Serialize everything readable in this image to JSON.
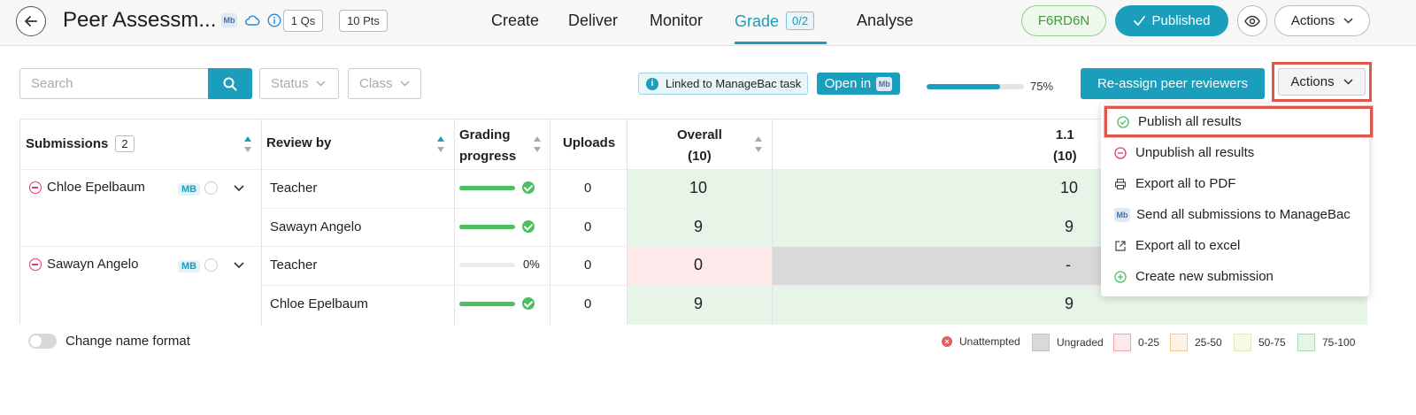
{
  "header": {
    "title": "Peer Assessm...",
    "mb_badge": "Mb",
    "questions": "1 Qs",
    "points": "10 Pts",
    "tabs": [
      {
        "label": "Create"
      },
      {
        "label": "Deliver"
      },
      {
        "label": "Monitor"
      },
      {
        "label": "Grade",
        "count": "0/2",
        "active": true
      },
      {
        "label": "Analyse"
      }
    ],
    "code": "F6RD6N",
    "published_label": "Published",
    "actions_label": "Actions"
  },
  "toolbar": {
    "search_placeholder": "Search",
    "status_filter": "Status",
    "class_filter": "Class",
    "linked_label": "Linked to ManageBac task",
    "open_in_label": "Open in",
    "open_in_badge": "Mb",
    "progress_percent": 75,
    "progress_text": "75%",
    "reassign_label": "Re-assign peer reviewers",
    "actions_label": "Actions"
  },
  "table": {
    "headers": {
      "submissions": "Submissions",
      "submissions_count": "2",
      "review_by": "Review by",
      "grading_progress_1": "Grading",
      "grading_progress_2": "progress",
      "uploads": "Uploads",
      "overall_1": "Overall",
      "overall_2": "(10)",
      "q11_1": "1.1",
      "q11_2": "(10)"
    },
    "rows": [
      {
        "student": "Chloe Epelbaum",
        "tag": "MB",
        "reviewer": "Teacher",
        "progress": 1.0,
        "progress_label": "",
        "uploads": "0",
        "overall": "10",
        "q11": "10",
        "band": "75-100"
      },
      {
        "student": "",
        "tag": "",
        "reviewer": "Sawayn Angelo",
        "progress": 1.0,
        "progress_label": "",
        "uploads": "0",
        "overall": "9",
        "q11": "9",
        "band": "75-100"
      },
      {
        "student": "Sawayn Angelo",
        "tag": "MB",
        "reviewer": "Teacher",
        "progress": 0.0,
        "progress_label": "0%",
        "uploads": "0",
        "overall": "0",
        "q11": "-",
        "band": "0-25"
      },
      {
        "student": "",
        "tag": "",
        "reviewer": "Chloe Epelbaum",
        "progress": 1.0,
        "progress_label": "",
        "uploads": "0",
        "overall": "9",
        "q11": "9",
        "band": "75-100"
      }
    ]
  },
  "footer": {
    "toggle_label": "Change name format",
    "legend": [
      {
        "label": "Unattempted"
      },
      {
        "label": "Ungraded",
        "color": "#d9d9d9",
        "border": "#c4c4c4"
      },
      {
        "label": "0-25",
        "color": "#fde9ea",
        "border": "#f0a7ae"
      },
      {
        "label": "25-50",
        "color": "#fef3e6",
        "border": "#f3c98f"
      },
      {
        "label": "50-75",
        "color": "#f7fbe6",
        "border": "#dfe9b0"
      },
      {
        "label": "75-100",
        "color": "#e7f5e8",
        "border": "#a9dcae"
      }
    ]
  },
  "dropdown": {
    "items": [
      {
        "label": "Publish all results",
        "icon": "check-circle-icon"
      },
      {
        "label": "Unpublish all results",
        "icon": "minus-circle-icon"
      },
      {
        "label": "Export all to PDF",
        "icon": "printer-icon"
      },
      {
        "label": "Send all submissions to ManageBac",
        "icon": "managebac-icon"
      },
      {
        "label": "Export all to excel",
        "icon": "external-link-icon"
      },
      {
        "label": "Create new submission",
        "icon": "plus-circle-icon"
      }
    ]
  },
  "colors": {
    "accent": "#1b9dbc",
    "highlight": "#e0574d",
    "green_band": "#e7f5e8",
    "red_band": "#fde9ea",
    "ungraded": "#d9d9d9"
  }
}
